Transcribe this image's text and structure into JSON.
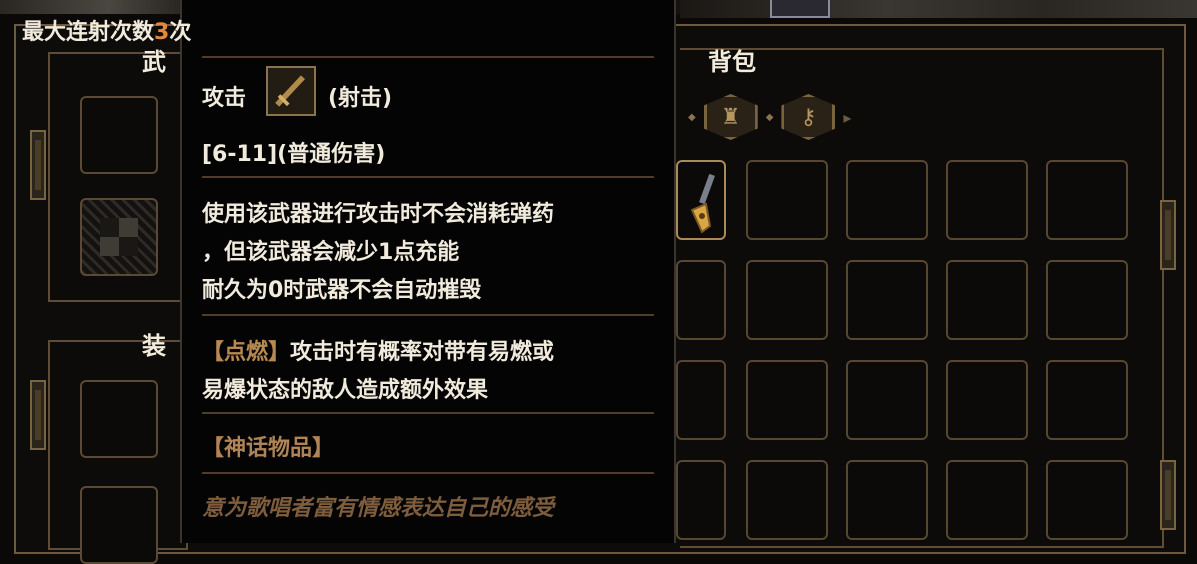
{
  "left_panel": {
    "weapon_title": "武",
    "equip_title": "装"
  },
  "bag": {
    "title": "背包",
    "tabs": [
      {
        "icon": "pouch-icon"
      },
      {
        "icon": "key-icon"
      }
    ]
  },
  "tooltip": {
    "max_shots_prefix": "最大连射次数",
    "max_shots_value": "3",
    "max_shots_suffix": "次",
    "attack_label": "攻击",
    "attack_type": "(射击)",
    "damage": "[6-11](普通伤害)",
    "desc_line1": "使用该武器进行攻击时不会消耗弹药",
    "desc_line2": "，但该武器会减少1点充能",
    "desc_line3": "耐久为0时武器不会自动摧毁",
    "ignite_tag": "【点燃】",
    "ignite_line1": "攻击时有概率对带有易燃或",
    "ignite_line2": "易爆状态的敌人造成额外效果",
    "rarity": "【神话物品】",
    "flavor": "意为歌唱者富有情感表达自己的感受"
  },
  "colors": {
    "accent_orange": "#e38a3a",
    "frame_gold": "#5e4d35",
    "flavor_brown": "#7e5d3d"
  }
}
